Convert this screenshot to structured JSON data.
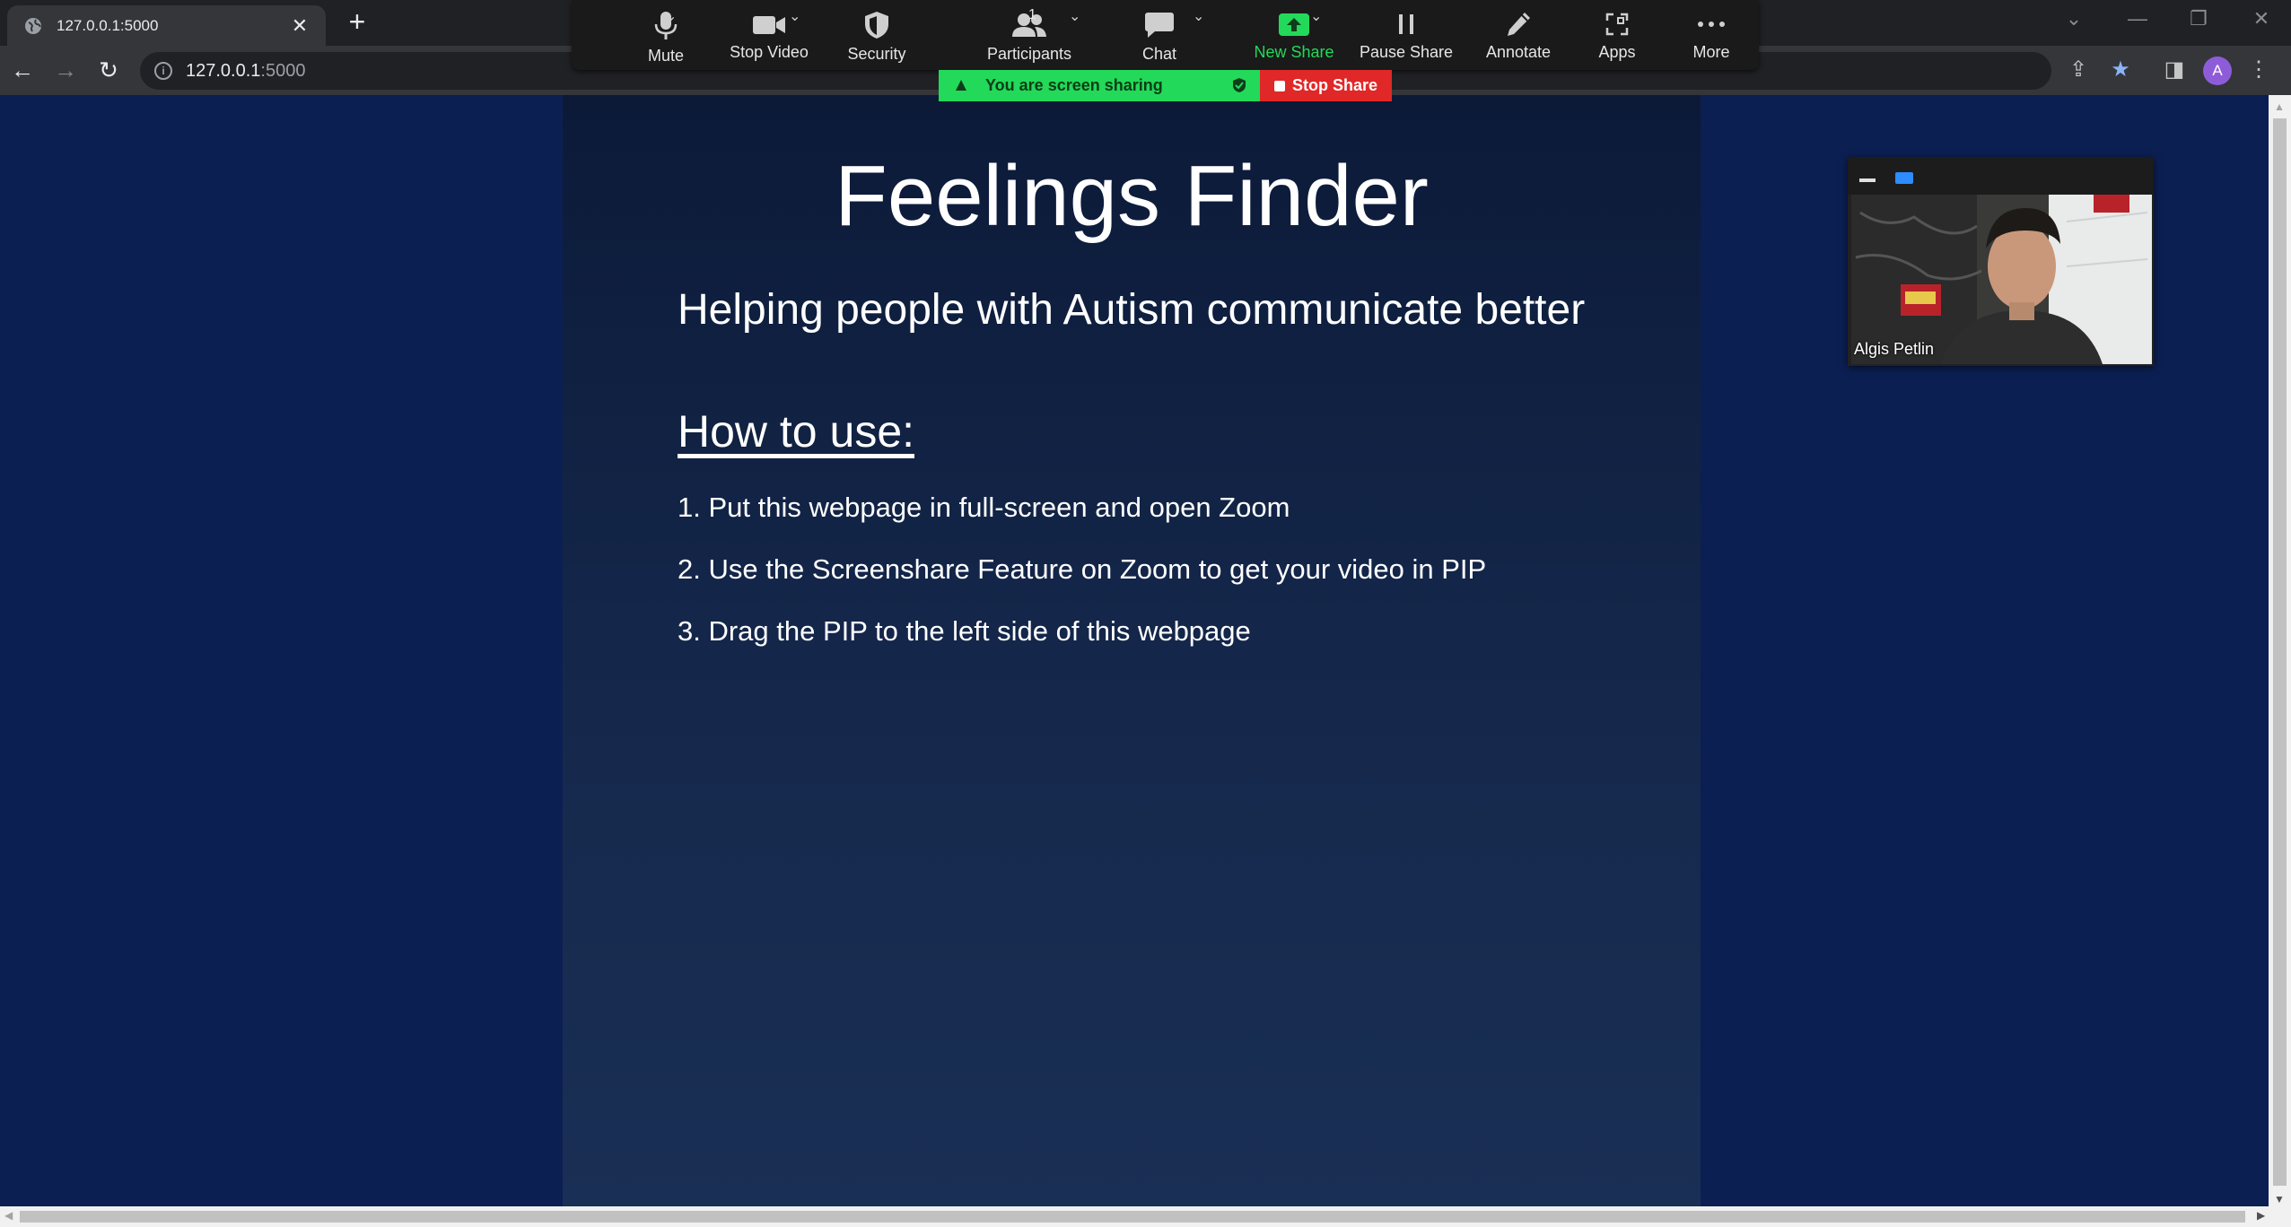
{
  "browser": {
    "tab_title": "127.0.0.1:5000",
    "tab_close_glyph": "✕",
    "new_tab_glyph": "+",
    "url_host": "127.0.0.1",
    "url_port": ":5000",
    "profile_initial": "A"
  },
  "zoom_toolbar": {
    "buttons": [
      {
        "label": "Mute",
        "icon": "microphone-icon"
      },
      {
        "label": "Stop Video",
        "icon": "video-camera-icon"
      },
      {
        "label": "Security",
        "icon": "shield-icon"
      },
      {
        "label": "Participants",
        "icon": "participants-icon",
        "count": "1"
      },
      {
        "label": "Chat",
        "icon": "chat-bubble-icon"
      },
      {
        "label": "New Share",
        "icon": "share-up-arrow-icon"
      },
      {
        "label": "Pause Share",
        "icon": "pause-icon"
      },
      {
        "label": "Annotate",
        "icon": "pencil-icon"
      },
      {
        "label": "Apps",
        "icon": "apps-icon"
      },
      {
        "label": "More",
        "icon": "more-dots-icon"
      }
    ],
    "sharing_banner": "You are screen sharing",
    "stop_share_label": "Stop Share",
    "new_share_color": "#23d959",
    "stop_share_color": "#e02828"
  },
  "page": {
    "title": "Feelings Finder",
    "subtitle": "Helping people with Autism communicate better",
    "how_to_heading": "How to use:",
    "steps": [
      "1. Put this webpage in full-screen and open Zoom",
      "2. Use the Screenshare Feature on Zoom to get your video in PIP",
      "3. Drag the PIP to the left side of this webpage"
    ],
    "background_color": "#0c1f52"
  },
  "pip": {
    "participant_name": "Algis Petlin"
  }
}
